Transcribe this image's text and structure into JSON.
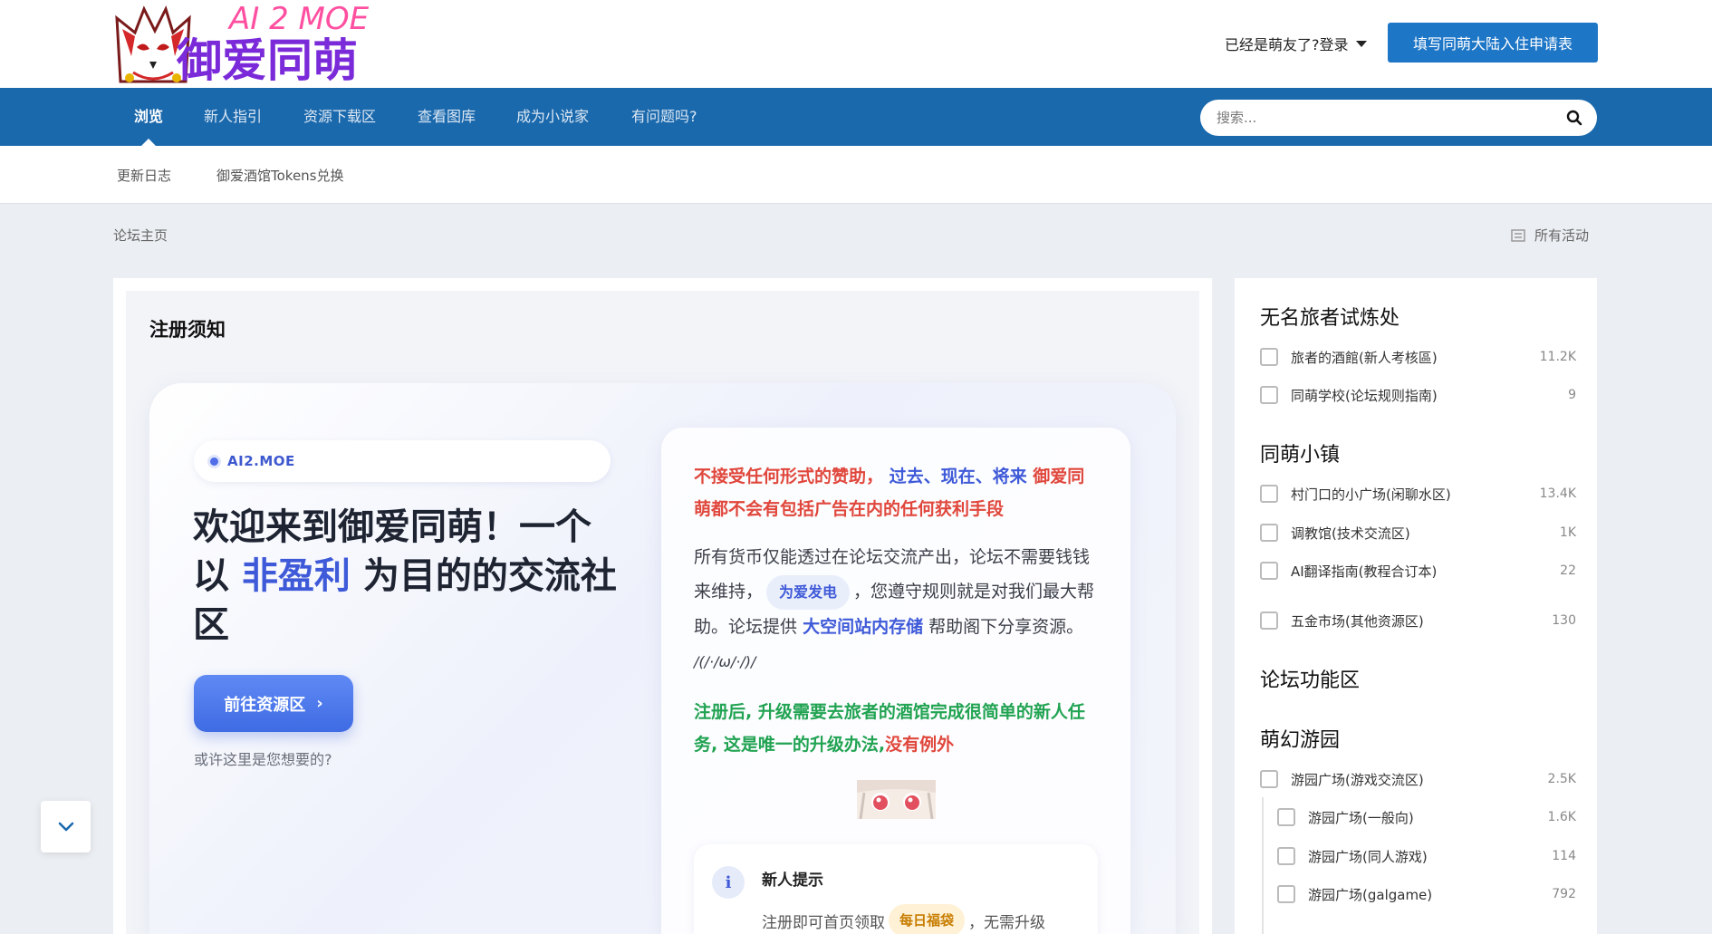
{
  "header": {
    "logo_text_top": "AI 2 MOE",
    "logo_text_main": "御爱同萌",
    "login_label": "已经是萌友了?登录",
    "apply_label": "填写同萌大陆入住申请表"
  },
  "nav": {
    "items": [
      "浏览",
      "新人指引",
      "资源下载区",
      "查看图库",
      "成为小说家",
      "有问题吗?"
    ],
    "search_placeholder": "搜索..."
  },
  "subnav": {
    "items": [
      "更新日志",
      "御爱酒馆Tokens兑换"
    ]
  },
  "breadcrumb": "论坛主页",
  "all_activity": "所有活动",
  "panel": {
    "title": "注册须知",
    "badge": "AI2.MOE",
    "hero_title_1": "欢迎来到御爱同萌！一个以",
    "hero_title_hl": "非盈利",
    "hero_title_2": "为目的的交流社区",
    "go_button": "前往资源区",
    "go_arrow": "›",
    "maybe": "或许这里是您想要的?",
    "warn_1": "不接受任何形式的赞助，",
    "warn_2": "过去、现在、将来",
    "warn_3": "御爱同萌都不会有包括广告在内的任何获利手段",
    "desc_1": "所有货币仅能透过在论坛交流产出，论坛不需要钱钱来维持，",
    "desc_pill": "为爱发电",
    "desc_2": "，您遵守规则就是对我们最大帮助。论坛提供",
    "desc_strong": "大空间站内存储",
    "desc_3": "帮助阁下分享资源。",
    "desc_kao": "/(/·/ω/·/)/",
    "green_1": "注册后, 升级需要去旅者的酒馆完成很简单的新人任务, 这是唯一的升级办法,",
    "green_red": "没有例外",
    "tip_icon": "i",
    "tip_title": "新人提示",
    "tip_text_1": "注册即可首页领取",
    "tip_pill": "每日福袋",
    "tip_text_2": "，无需升级"
  },
  "sidebar": {
    "sections": [
      {
        "title": "无名旅者试炼处",
        "forums": [
          {
            "name": "旅者的酒館(新人考核區)",
            "count": "11.2K"
          },
          {
            "name": "同萌学校(论坛规则指南)",
            "count": "9"
          }
        ]
      },
      {
        "title": "同萌小镇",
        "forums": [
          {
            "name": "村门口的小广场(闲聊水区)",
            "count": "13.4K"
          },
          {
            "name": "调教馆(技术交流区)",
            "count": "1K"
          },
          {
            "name": "AI翻译指南(教程合订本)",
            "count": "22"
          },
          {
            "name": "五金市场(其他资源区)",
            "count": "130"
          }
        ]
      },
      {
        "title": "论坛功能区",
        "forums": []
      },
      {
        "title": "萌幻游园",
        "forums": [
          {
            "name": "游园广场(游戏交流区)",
            "count": "2.5K"
          },
          {
            "name": "游园广场(一般向)",
            "count": "1.6K"
          },
          {
            "name": "游园广场(同人游戏)",
            "count": "114"
          },
          {
            "name": "游园广场(galgame)",
            "count": "792"
          }
        ]
      }
    ]
  },
  "colors": {
    "brand_blue": "#1b69ad",
    "button_blue": "#1e76c7",
    "accent": "#3f5ad8",
    "warn_red": "#e0473c",
    "green": "#21a352"
  },
  "icons": [
    "fox-mask-logo",
    "caret-down-icon",
    "search-icon",
    "activity-icon",
    "chevron-right-icon",
    "info-icon",
    "mascot-image",
    "chevron-down-icon"
  ]
}
